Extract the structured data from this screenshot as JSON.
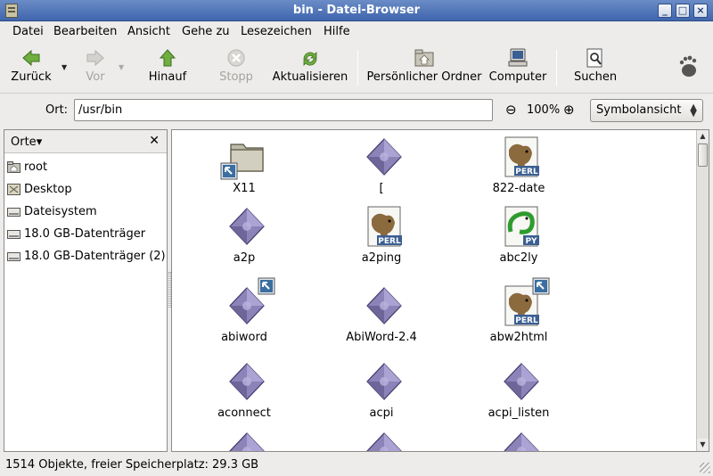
{
  "window": {
    "title": "bin - Datei-Browser"
  },
  "menu": [
    "Datei",
    "Bearbeiten",
    "Ansicht",
    "Gehe zu",
    "Lesezeichen",
    "Hilfe"
  ],
  "toolbar": {
    "back": "Zurück",
    "forward": "Vor",
    "up": "Hinauf",
    "stop": "Stopp",
    "reload": "Aktualisieren",
    "home": "Persönlicher Ordner",
    "computer": "Computer",
    "search": "Suchen"
  },
  "location": {
    "label": "Ort:",
    "path": "/usr/bin",
    "zoom": "100%",
    "view_mode": "Symbolansicht"
  },
  "sidebar": {
    "title": "Orte",
    "items": [
      {
        "label": "root",
        "icon": "home-folder-icon"
      },
      {
        "label": "Desktop",
        "icon": "desktop-icon"
      },
      {
        "label": "Dateisystem",
        "icon": "drive-icon"
      },
      {
        "label": "18.0 GB-Datenträger",
        "icon": "drive-icon"
      },
      {
        "label": "18.0 GB-Datenträger (2)",
        "icon": "drive-icon"
      }
    ]
  },
  "files": [
    {
      "name": "X11",
      "type": "folder",
      "link": true
    },
    {
      "name": "[",
      "type": "exec",
      "link": false
    },
    {
      "name": "822-date",
      "type": "perl",
      "link": false
    },
    {
      "name": "a2p",
      "type": "exec",
      "link": false
    },
    {
      "name": "a2ping",
      "type": "perl",
      "link": false
    },
    {
      "name": "abc2ly",
      "type": "python",
      "link": false
    },
    {
      "name": "abiword",
      "type": "exec",
      "link": true
    },
    {
      "name": "AbiWord-2.4",
      "type": "exec",
      "link": false
    },
    {
      "name": "abw2html",
      "type": "perl",
      "link": true
    },
    {
      "name": "aconnect",
      "type": "exec",
      "link": false
    },
    {
      "name": "acpi",
      "type": "exec",
      "link": false
    },
    {
      "name": "acpi_listen",
      "type": "exec",
      "link": false
    },
    {
      "name": "",
      "type": "exec",
      "link": false
    },
    {
      "name": "",
      "type": "exec",
      "link": false
    },
    {
      "name": "",
      "type": "exec",
      "link": false
    }
  ],
  "status": {
    "text": "1514 Objekte, freier Speicherplatz: 29.3 GB"
  }
}
